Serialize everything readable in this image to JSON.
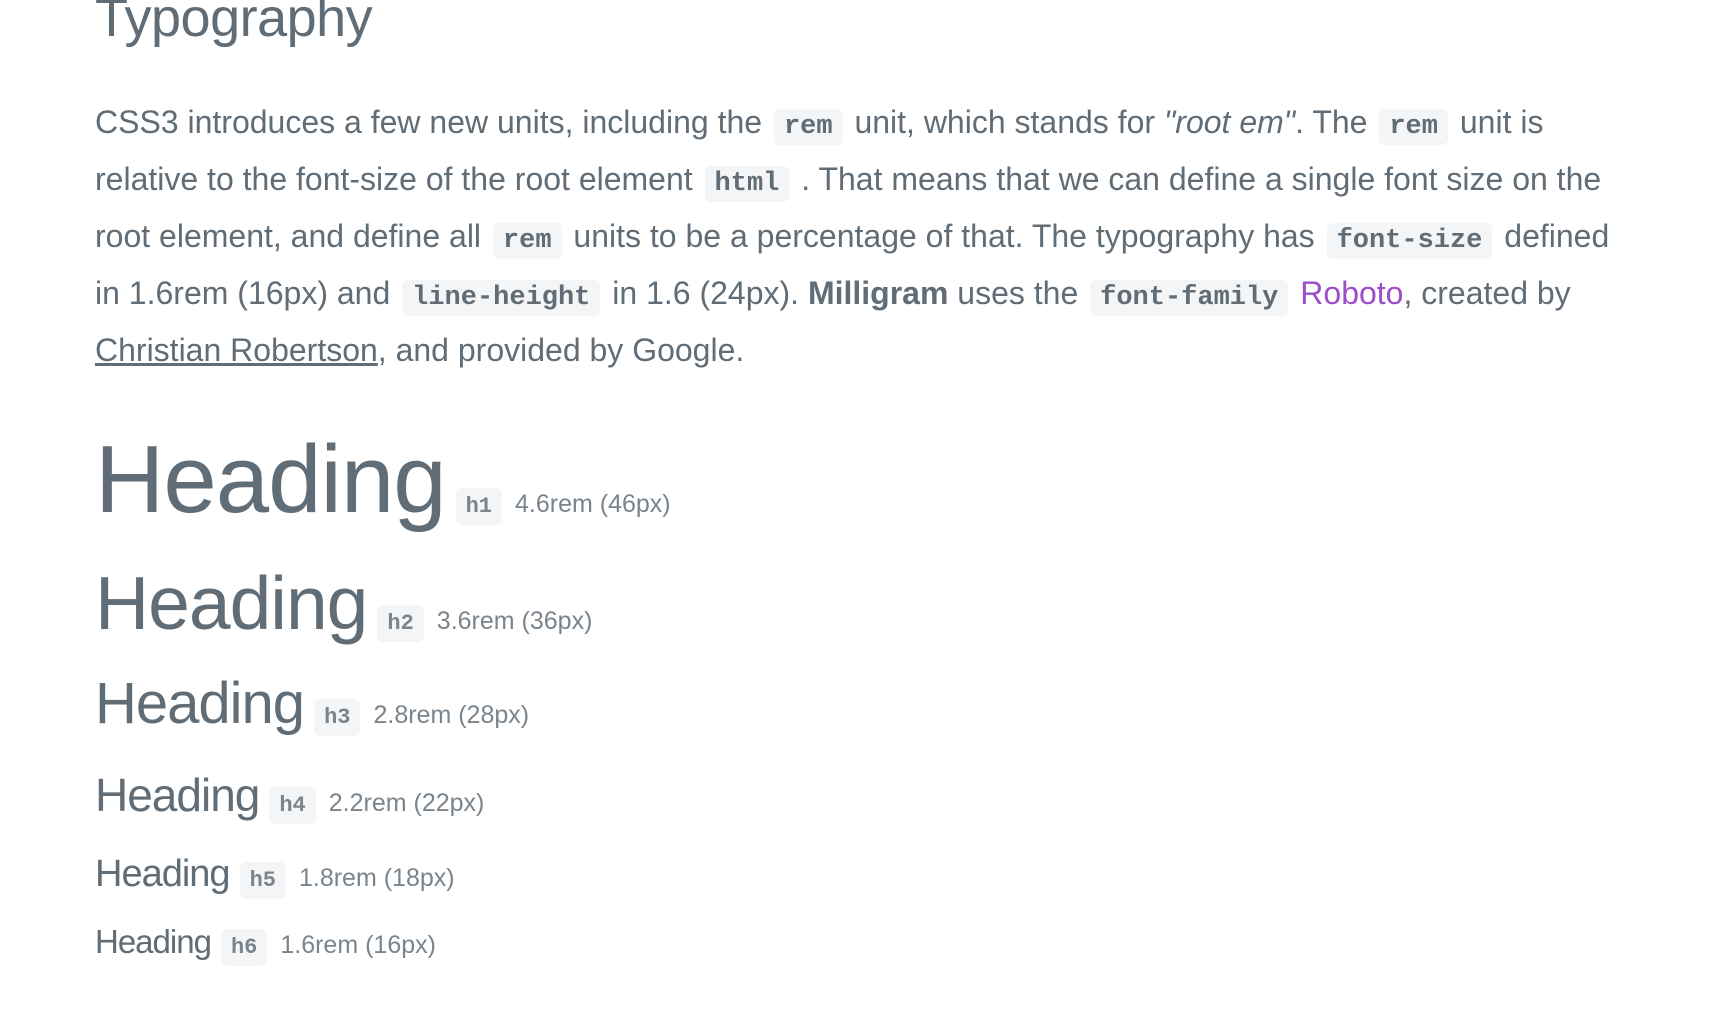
{
  "section": {
    "title": "Typography"
  },
  "intro": {
    "t1": "CSS3 introduces a few new units, including the ",
    "c1": "rem",
    "t2": " unit, which stands for ",
    "em1": "\"root em\"",
    "t3": ". The ",
    "c2": "rem",
    "t4": " unit is relative to the font-size of the root element ",
    "c3": "html",
    "t5": " . That means that we can define a single font size on the root element, and define all ",
    "c4": "rem",
    "t6": " units to be a percentage of that. The typography has ",
    "c5": "font-size",
    "t7": " defined in 1.6rem (16px) and ",
    "c6": "line-height",
    "t8": " in 1.6 (24px). ",
    "strong1": "Milligram",
    "t9": " uses the ",
    "c7": "font-family",
    "t10": " ",
    "link_roboto": "Roboto",
    "t11": ", created by ",
    "link_author": "Christian Robertson",
    "t12": ", and provided by Google."
  },
  "headings": [
    {
      "text": "Heading",
      "tag": "h1",
      "size": "4.6rem (46px)"
    },
    {
      "text": "Heading",
      "tag": "h2",
      "size": "3.6rem (36px)"
    },
    {
      "text": "Heading",
      "tag": "h3",
      "size": "2.8rem (28px)"
    },
    {
      "text": "Heading",
      "tag": "h4",
      "size": "2.2rem (22px)"
    },
    {
      "text": "Heading",
      "tag": "h5",
      "size": "1.8rem (18px)"
    },
    {
      "text": "Heading",
      "tag": "h6",
      "size": "1.6rem (16px)"
    }
  ],
  "colors": {
    "text": "#606c76",
    "code_background": "#f4f5f6",
    "link_accent": "#9b4dca"
  }
}
